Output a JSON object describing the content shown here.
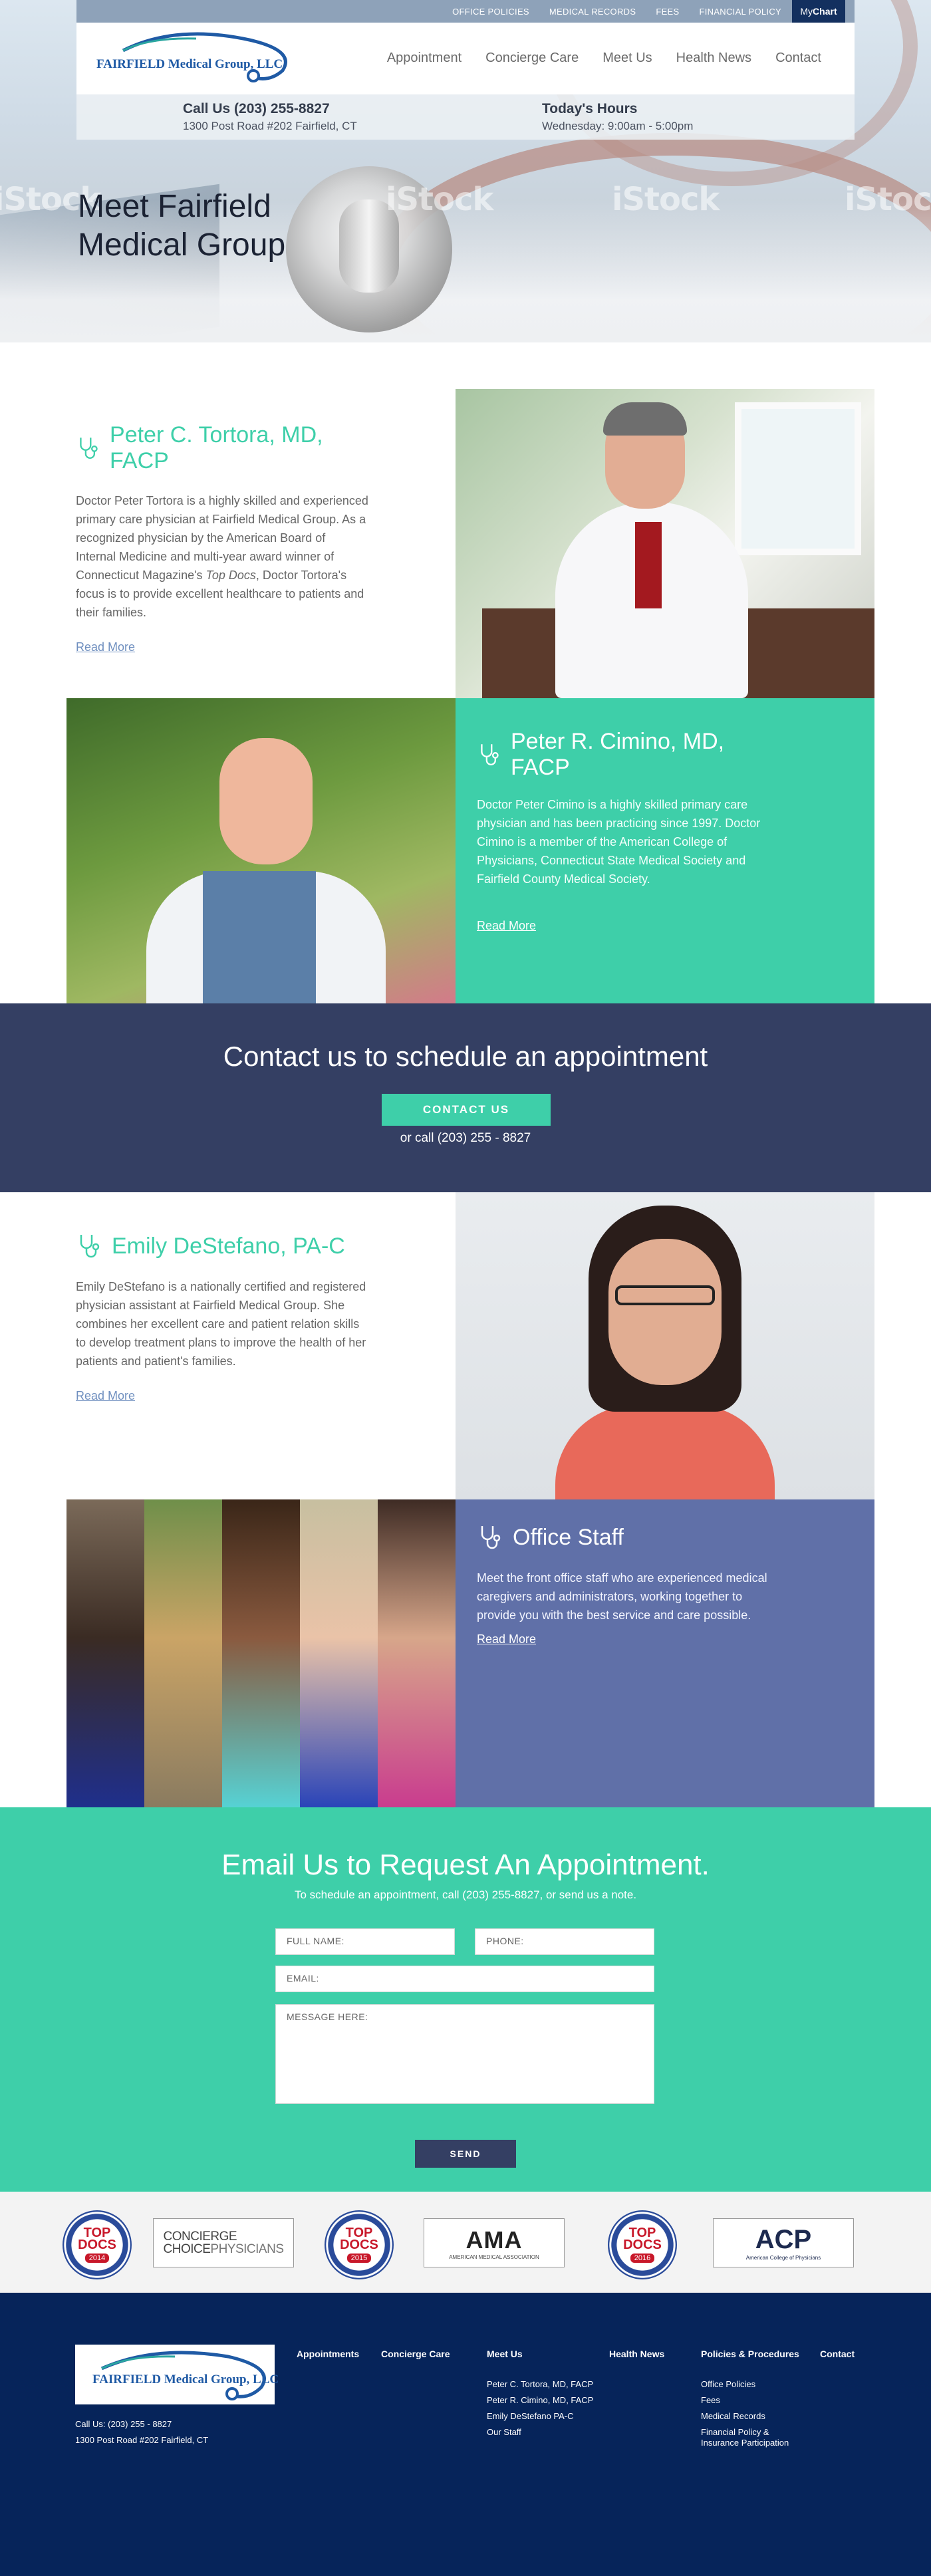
{
  "header": {
    "top_links": [
      "OFFICE POLICIES",
      "MEDICAL RECORDS",
      "FEES",
      "FINANCIAL POLICY"
    ],
    "mychart": {
      "my": "My",
      "chart": "Chart"
    },
    "logo_text": "FAIRFIELD Medical Group, LLC",
    "nav": [
      "Appointment",
      "Concierge Care",
      "Meet Us",
      "Health News",
      "Contact"
    ],
    "call_title": "Call Us (203) 255-8827",
    "address": "1300 Post Road #202 Fairfield, CT",
    "hours_title": "Today's Hours",
    "hours": "Wednesday: 9:00am - 5:00pm"
  },
  "hero": {
    "title_line1": "Meet Fairfield",
    "title_line2": "Medical Group",
    "watermark": "iStock"
  },
  "doctors": [
    {
      "name": "Peter C. Tortora, MD, FACP",
      "bio_before": "Doctor Peter Tortora is a highly skilled and experienced primary care physician at Fairfield Medical Group. As a recognized physician by the American Board of Internal Medicine and multi-year award winner of Connecticut Magazine's ",
      "bio_italic": "Top Docs",
      "bio_after": ", Doctor Tortora's focus is to provide excellent healthcare to patients and their families.",
      "read_more": "Read More"
    },
    {
      "name": "Peter R. Cimino, MD, FACP",
      "bio": "Doctor Peter Cimino is a highly skilled primary care physician and has been practicing since 1997. Doctor Cimino is a member of the American College of Physicians, Connecticut State Medical Society and Fairfield County Medical Society.",
      "read_more": "Read More"
    },
    {
      "name": "Emily DeStefano, PA-C",
      "bio": "Emily DeStefano is a nationally certified and registered physician assistant at Fairfield Medical Group. She combines her excellent care and patient relation skills to develop treatment plans to improve the health of her patients and patient's families.",
      "read_more": "Read More"
    },
    {
      "name": "Office Staff",
      "bio": "Meet the front office staff who are experienced medical caregivers and  administrators, working together to provide you with the best service and care possible.",
      "read_more": "Read More"
    }
  ],
  "cta": {
    "title": "Contact us to schedule an appointment",
    "button": "CONTACT US",
    "call": "or call (203) 255 - 8827"
  },
  "email_form": {
    "title": "Email Us to Request An Appointment.",
    "subtitle": "To schedule an appointment, call (203) 255-8827, or send us a note.",
    "full_name": "FULL NAME:",
    "phone": "PHONE:",
    "email": "EMAIL:",
    "message": "MESSAGE HERE:",
    "send": "SEND"
  },
  "badges": {
    "topdocs": [
      {
        "top": "TOP",
        "docs": "DOCS",
        "year": "2014"
      },
      {
        "top": "TOP",
        "docs": "DOCS",
        "year": "2015"
      },
      {
        "top": "TOP",
        "docs": "DOCS",
        "year": "2016"
      }
    ],
    "concierge_line1": "CONCIERGE",
    "concierge_line2": "CHOICE",
    "concierge_line3": "PHYSICIANS",
    "ama": "AMA",
    "ama_sub": "AMERICAN MEDICAL ASSOCIATION",
    "acp": "ACP",
    "acp_sub": "American College of Physicians"
  },
  "footer": {
    "logo_text": "FAIRFIELD Medical Group, LLC",
    "phone": "Call Us: (203) 255 - 8827",
    "address": "1300 Post Road #202 Fairfield, CT",
    "columns": [
      {
        "title": "Appointments",
        "items": []
      },
      {
        "title": "Concierge Care",
        "items": []
      },
      {
        "title": "Meet Us",
        "items": [
          "Peter C. Tortora, MD, FACP",
          "Peter R. Cimino, MD, FACP",
          "Emily DeStefano PA-C",
          "Our Staff"
        ]
      },
      {
        "title": "Health News",
        "items": []
      },
      {
        "title": "Policies & Procedures",
        "items": [
          "Office Policies",
          "Fees",
          "Medical Records",
          "Financial Policy &",
          "Insurance Participation"
        ]
      },
      {
        "title": "Contact",
        "items": []
      }
    ]
  },
  "colors": {
    "teal": "#3ecfa9",
    "navy": "#343f63",
    "footer_navy": "#06245a",
    "periwinkle": "#6070a8",
    "brand_blue": "#1f5aa5"
  }
}
